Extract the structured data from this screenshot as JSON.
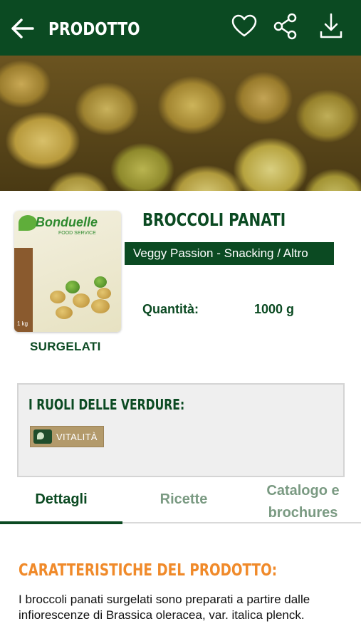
{
  "appbar": {
    "title": "PRODOTTO",
    "icons": [
      "back-arrow-icon",
      "heart-icon",
      "share-icon",
      "download-icon"
    ]
  },
  "product": {
    "name": "BROCCOLI PANATI",
    "category": "Veggy Passion - Snacking / Altro",
    "quantity_label": "Quantità:",
    "quantity_value": "1000 g",
    "storage": "SURGELATI",
    "package": {
      "brand": "Bonduelle",
      "brand_sub": "FOOD SERVICE",
      "weight": "1 kg"
    }
  },
  "roles": {
    "title": "I RUOLI DELLE VERDURE:",
    "badges": [
      {
        "label": "VITALITÀ",
        "icon": "leaf-icon"
      }
    ]
  },
  "tabs": [
    {
      "label": "Dettagli",
      "active": true
    },
    {
      "label": "Ricette",
      "active": false
    },
    {
      "label": "Catalogo e brochures",
      "active": false
    }
  ],
  "details": {
    "title": "CARATTERISTICHE DEL PRODOTTO:",
    "description": "I broccoli panati surgelati sono preparati a partire dalle infiorescenze di Brassica oleracea, var. italica plenck."
  },
  "colors": {
    "primary": "#0b4a22",
    "accent": "#f08a2a",
    "badge": "#b39a6b",
    "inactive_tab": "#7a9a82"
  }
}
